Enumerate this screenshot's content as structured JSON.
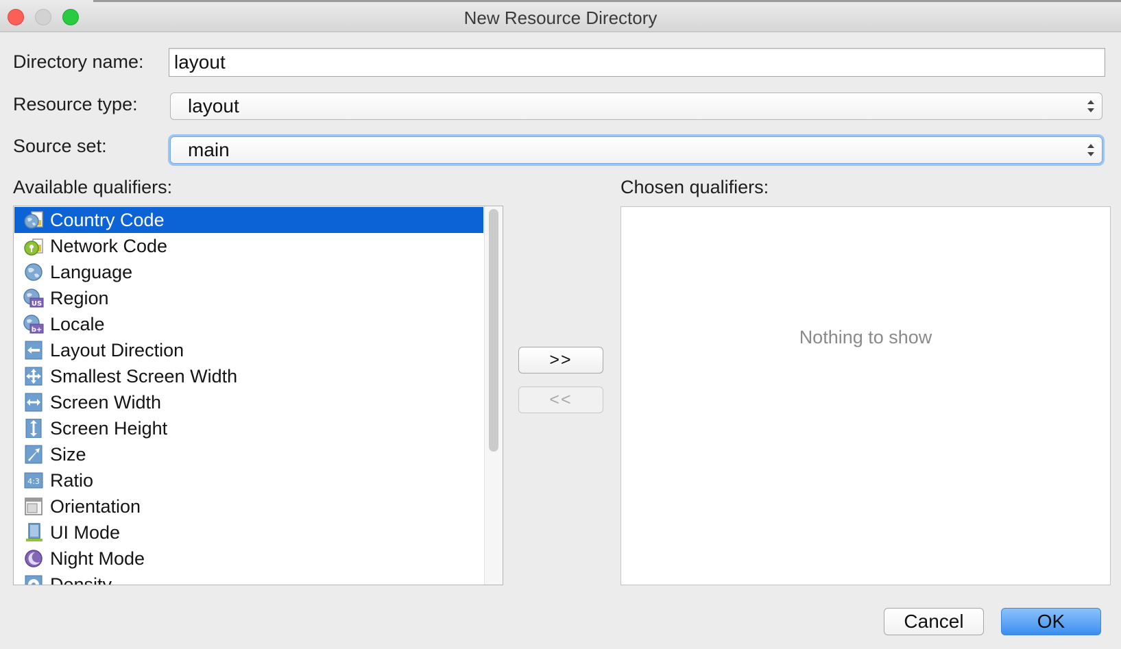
{
  "window": {
    "title": "New Resource Directory"
  },
  "form": {
    "directory_name_label": "Directory name:",
    "directory_name_value": "layout",
    "resource_type_label": "Resource type:",
    "resource_type_value": "layout",
    "source_set_label": "Source set:",
    "source_set_value": "main"
  },
  "available": {
    "label": "Available qualifiers:",
    "items": [
      {
        "label": "Country Code",
        "icon": "country-code-icon"
      },
      {
        "label": "Network Code",
        "icon": "network-code-icon"
      },
      {
        "label": "Language",
        "icon": "globe-icon"
      },
      {
        "label": "Region",
        "icon": "region-icon"
      },
      {
        "label": "Locale",
        "icon": "locale-icon"
      },
      {
        "label": "Layout Direction",
        "icon": "layout-direction-icon"
      },
      {
        "label": "Smallest Screen Width",
        "icon": "smallest-screen-width-icon"
      },
      {
        "label": "Screen Width",
        "icon": "screen-width-icon"
      },
      {
        "label": "Screen Height",
        "icon": "screen-height-icon"
      },
      {
        "label": "Size",
        "icon": "size-icon"
      },
      {
        "label": "Ratio",
        "icon": "ratio-icon"
      },
      {
        "label": "Orientation",
        "icon": "orientation-icon"
      },
      {
        "label": "UI Mode",
        "icon": "ui-mode-icon"
      },
      {
        "label": "Night Mode",
        "icon": "night-mode-icon"
      },
      {
        "label": "Density",
        "icon": "density-icon"
      }
    ],
    "selected_index": 0,
    "region_badge": "US",
    "locale_badge": "b+",
    "ratio_badge": "4:3"
  },
  "move": {
    "add_label": ">>",
    "remove_label": "<<"
  },
  "chosen": {
    "label": "Chosen qualifiers:",
    "empty_text": "Nothing to show"
  },
  "buttons": {
    "cancel_label": "Cancel",
    "ok_label": "OK"
  },
  "colors": {
    "selection": "#0b63d6",
    "ok_button": "#3b8ef0",
    "focus_ring": "#9cc6f2"
  }
}
